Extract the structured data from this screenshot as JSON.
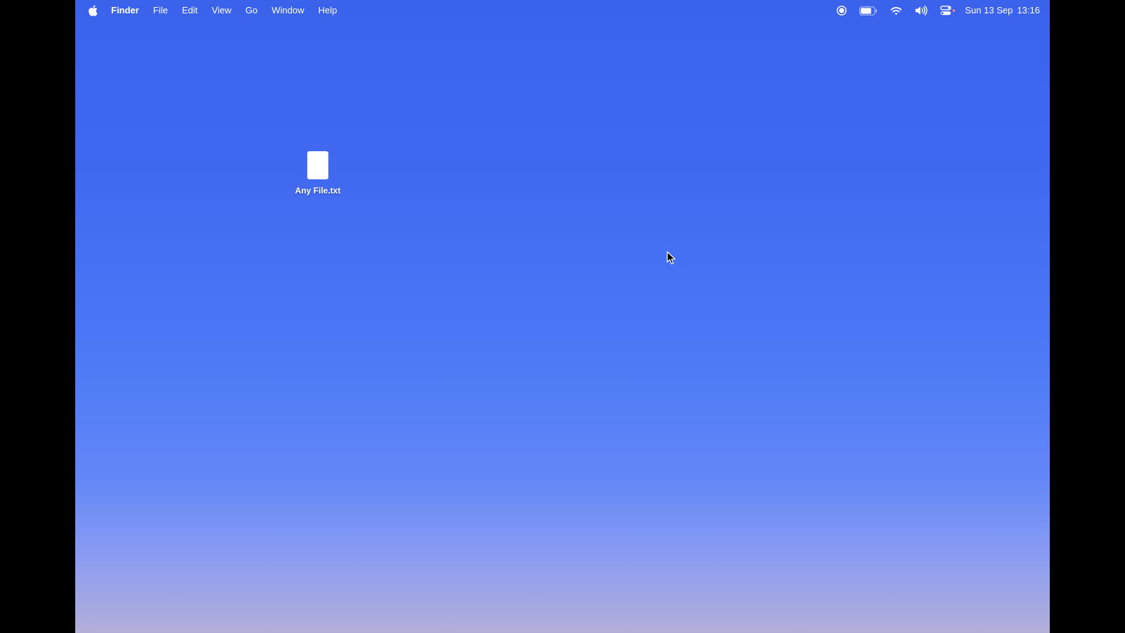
{
  "menubar": {
    "apple_icon": "apple-icon",
    "app_name": "Finder",
    "menus": [
      "File",
      "Edit",
      "View",
      "Go",
      "Window",
      "Help"
    ],
    "status_icons": [
      "screen-record-icon",
      "battery-icon",
      "wifi-icon",
      "volume-icon",
      "control-center-icon"
    ],
    "clock": {
      "date": "Sun 13 Sep",
      "time": "13:16"
    }
  },
  "desktop": {
    "files": [
      {
        "name": "Any File.txt",
        "icon": "text-file-icon"
      }
    ],
    "cursor_icon": "cursor-arrow-icon"
  },
  "colors": {
    "wallpaper_top": "#3a62ea",
    "wallpaper_bottom": "#b3afd8",
    "menu_text": "#ffffff"
  }
}
